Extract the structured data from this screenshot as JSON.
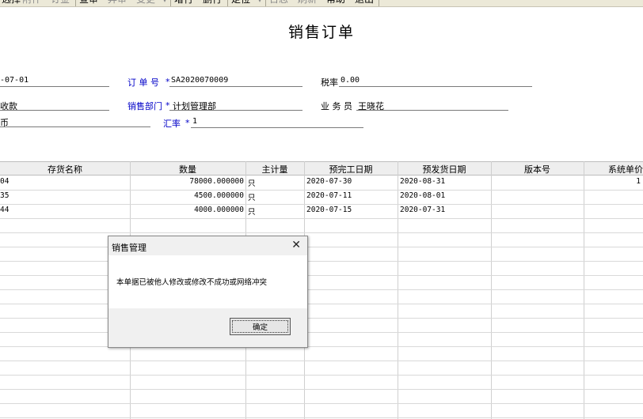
{
  "toolbar": {
    "items": [
      "选择",
      "附件",
      "订金",
      "查审",
      "弃审",
      "变更",
      "增行",
      "删行",
      "定位",
      "日志",
      "刷新",
      "帮助",
      "退出"
    ]
  },
  "form": {
    "title": "销售订单",
    "date_value": "-07-01",
    "order_no_label": "订 单 号",
    "order_no_value": "SA2020070009",
    "tax_rate_label": "税率",
    "tax_rate_value": "0.00",
    "payment_value": "收款",
    "dept_label": "销售部门",
    "dept_value": "计划管理部",
    "salesperson_label": "业 务 员",
    "salesperson_value": "王晓花",
    "currency_value": "币",
    "exchange_label": "汇率",
    "exchange_value": "1",
    "required_mark": "*"
  },
  "grid": {
    "columns": [
      "存货名称",
      "数量",
      "主计量",
      "预完工日期",
      "预发货日期",
      "版本号",
      "系统单价"
    ],
    "rows": [
      {
        "name": "04",
        "qty": "78000.000000",
        "unit": "只",
        "finish": "2020-07-30",
        "ship": "2020-08-31",
        "ver": "",
        "price": "1"
      },
      {
        "name": "35",
        "qty": "4500.000000",
        "unit": "只",
        "finish": "2020-07-11",
        "ship": "2020-08-01",
        "ver": "",
        "price": ""
      },
      {
        "name": "44",
        "qty": "4000.000000",
        "unit": "只",
        "finish": "2020-07-15",
        "ship": "2020-07-31",
        "ver": "",
        "price": ""
      }
    ]
  },
  "dialog": {
    "title": "销售管理",
    "message": "本单据已被他人修改或修改不成功或网络冲突",
    "ok_label": "确定"
  }
}
